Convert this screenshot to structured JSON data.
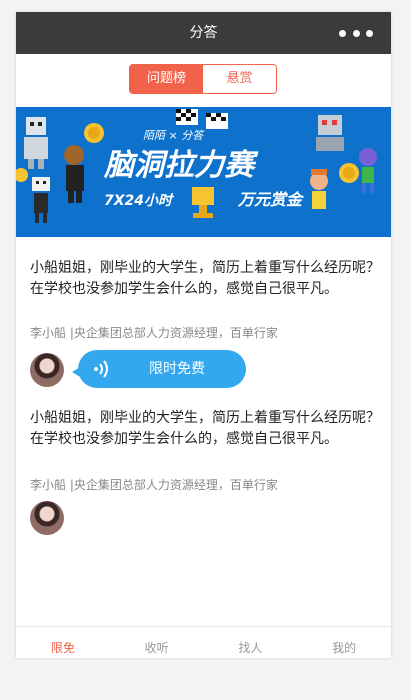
{
  "header": {
    "title": "分答"
  },
  "segments": [
    {
      "label": "问题榜",
      "active": true
    },
    {
      "label": "悬赏",
      "active": false
    }
  ],
  "banner": {
    "brand": "陌陌 × 分答",
    "headline": "脑洞拉力赛",
    "tagline": "7X24小时",
    "prize": "万元赏金"
  },
  "posts": [
    {
      "question": "小船姐姐，刚毕业的大学生，简历上着重写什么经历呢？在学校也没参加学生会什么的，感觉自己很平凡。",
      "meta": "李小船 |央企集团总部人力资源经理，百单行家",
      "answer_label": "限时免费"
    },
    {
      "question": "小船姐姐，刚毕业的大学生，简历上着重写什么经历呢？在学校也没参加学生会什么的，感觉自己很平凡。",
      "meta": "李小船 |央企集团总部人力资源经理，百单行家"
    }
  ],
  "tabbar": [
    {
      "label": "限免",
      "active": true
    },
    {
      "label": "收听",
      "active": false
    },
    {
      "label": "找人",
      "active": false
    },
    {
      "label": "我的",
      "active": false
    }
  ],
  "colors": {
    "accent": "#f0624a",
    "header_bg": "#3b3b3b",
    "bubble": "#33a8ef",
    "banner_bg": "#0e72cd"
  }
}
